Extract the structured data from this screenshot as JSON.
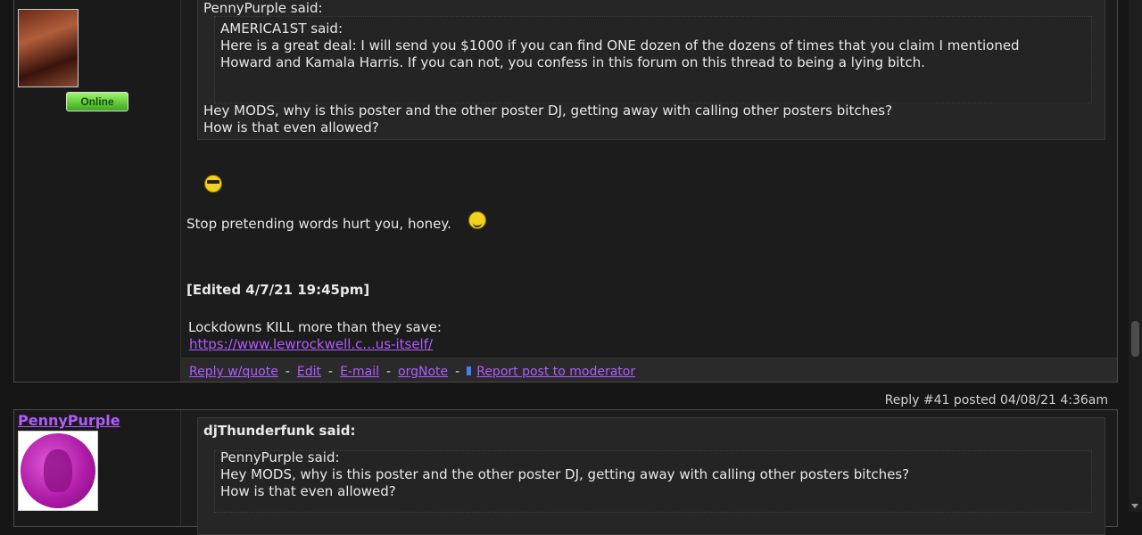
{
  "post1": {
    "quote_author_label": "PennyPurple said:",
    "nested_quote_author_label": "AMERICA1ST said:",
    "nested_quote_line1": "Here is a great deal: I will send you $1000 if you can find ONE dozen of the dozens of times that you claim I mentioned",
    "nested_quote_line2": "Howard and Kamala Harris. If you can not, you confess in this forum on this thread to being a lying bitch.",
    "quote_line1": "Hey MODS, why is this poster and the other poster DJ, getting away with calling other posters bitches?",
    "quote_line2": "How is that even allowed?",
    "body_text": "Stop pretending words hurt you, honey.",
    "edited_label": "[Edited 4/7/21 19:45pm]",
    "signature_text": "Lockdowns KILL more than they save:",
    "signature_link": "https://www.lewrockwell.c...us-itself/",
    "online_badge": "Online",
    "actions": {
      "reply_quote": "Reply w/quote",
      "edit": "Edit",
      "email": "E-mail",
      "orgnote": "orgNote",
      "report": "Report post to moderator",
      "separator": "-"
    }
  },
  "reply_info": "Reply #41 posted 04/08/21 4:36am",
  "post2": {
    "username": "PennyPurple",
    "quote_author_label": "djThunderfunk said:",
    "nested_quote_author_label": "PennyPurple said:",
    "nested_quote_line1": "Hey MODS, why is this poster and the other poster DJ, getting away with calling other posters bitches?",
    "nested_quote_line2": "How is that even allowed?"
  },
  "colors": {
    "link": "#b15cff",
    "background": "#161616",
    "quote_background": "#262626"
  }
}
